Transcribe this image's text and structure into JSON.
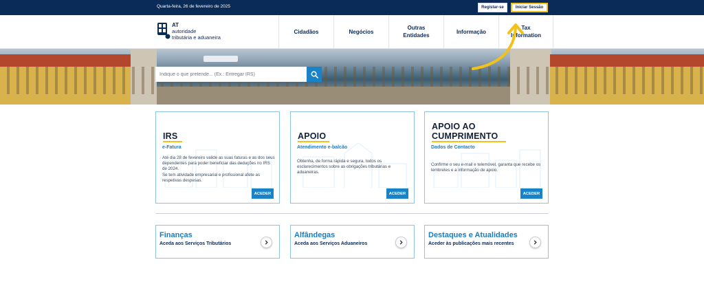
{
  "topbar": {
    "date": "Quarta-feira, 26 de fevereiro de 2025",
    "register_label": "Registar-se",
    "login_label": "Iniciar Sessão"
  },
  "header": {
    "logo": {
      "abbr": "AT",
      "line1": "autoridade",
      "line2": "tributária e aduaneira"
    },
    "nav": [
      {
        "label": "Cidadãos"
      },
      {
        "label": "Negócios"
      },
      {
        "label": "Outras\nEntidades"
      },
      {
        "label": "Informação"
      },
      {
        "label": "Tax\nInformation"
      }
    ]
  },
  "search": {
    "placeholder": "Indique o que pretende... (Ex.: Entregar IRS)",
    "icon": "search-icon"
  },
  "cards": [
    {
      "title": "IRS",
      "subtitle": "e-Fatura",
      "description": "Até dia 28 de fevereiro valide as suas faturas e as dos seus dependentes para poder beneficiar das deduções no IRS de 2024.\nSe tem atividade empresarial e profissional afete as respetivas despesas.",
      "button": "ACEDER"
    },
    {
      "title": "APOIO",
      "subtitle": "Atendimento e-balcão",
      "description": "Obtenha, de forma rápida e segura, todos os esclarecimentos sobre as obrigações tributárias e aduaneiras.",
      "button": "ACEDER"
    },
    {
      "title": "APOIO AO\nCUMPRIMENTO",
      "subtitle": "Dados de Contacto",
      "description": "Confirme o seu e-mail e telemóvel, garanta que recebe os lembretes e a informação de apoio.",
      "button": "ACEDER"
    }
  ],
  "links": [
    {
      "title": "Finanças",
      "subtitle": "Aceda aos Serviços Tributários"
    },
    {
      "title": "Alfândegas",
      "subtitle": "Aceda aos Serviços Aduaneiros"
    },
    {
      "title": "Destaques e Atualidades",
      "subtitle": "Aceder às publicações mais recentes"
    }
  ],
  "colors": {
    "navy": "#0a2a57",
    "accent_blue": "#1a83c8",
    "highlight_yellow": "#f2c21a"
  }
}
